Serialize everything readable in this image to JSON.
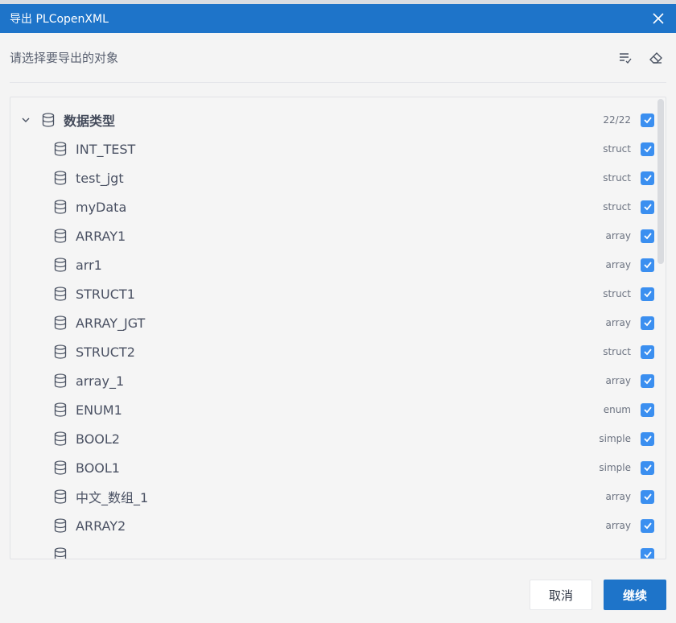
{
  "dialog": {
    "title": "导出 PLCopenXML",
    "prompt": "请选择要导出的对象",
    "close_icon": "close-icon",
    "tools": [
      "sort-check-icon",
      "eraser-icon"
    ]
  },
  "tree": {
    "root": {
      "label": "数据类型",
      "count": "22/22",
      "checked": true
    },
    "items": [
      {
        "label": "INT_TEST",
        "type": "struct",
        "checked": true
      },
      {
        "label": "test_jgt",
        "type": "struct",
        "checked": true
      },
      {
        "label": "myData",
        "type": "struct",
        "checked": true
      },
      {
        "label": "ARRAY1",
        "type": "array",
        "checked": true
      },
      {
        "label": "arr1",
        "type": "array",
        "checked": true
      },
      {
        "label": "STRUCT1",
        "type": "struct",
        "checked": true
      },
      {
        "label": "ARRAY_JGT",
        "type": "array",
        "checked": true
      },
      {
        "label": "STRUCT2",
        "type": "struct",
        "checked": true
      },
      {
        "label": "array_1",
        "type": "array",
        "checked": true
      },
      {
        "label": "ENUM1",
        "type": "enum",
        "checked": true
      },
      {
        "label": "BOOL2",
        "type": "simple",
        "checked": true
      },
      {
        "label": "BOOL1",
        "type": "simple",
        "checked": true
      },
      {
        "label": "中文_数组_1",
        "type": "array",
        "checked": true
      },
      {
        "label": "ARRAY2",
        "type": "array",
        "checked": true
      },
      {
        "label": "",
        "type": "",
        "checked": true
      }
    ]
  },
  "footer": {
    "cancel_label": "取消",
    "continue_label": "继续"
  },
  "colors": {
    "titlebar": "#1e74c9",
    "checkbox": "#3b8ff0",
    "primary_button": "#1e74c9"
  }
}
